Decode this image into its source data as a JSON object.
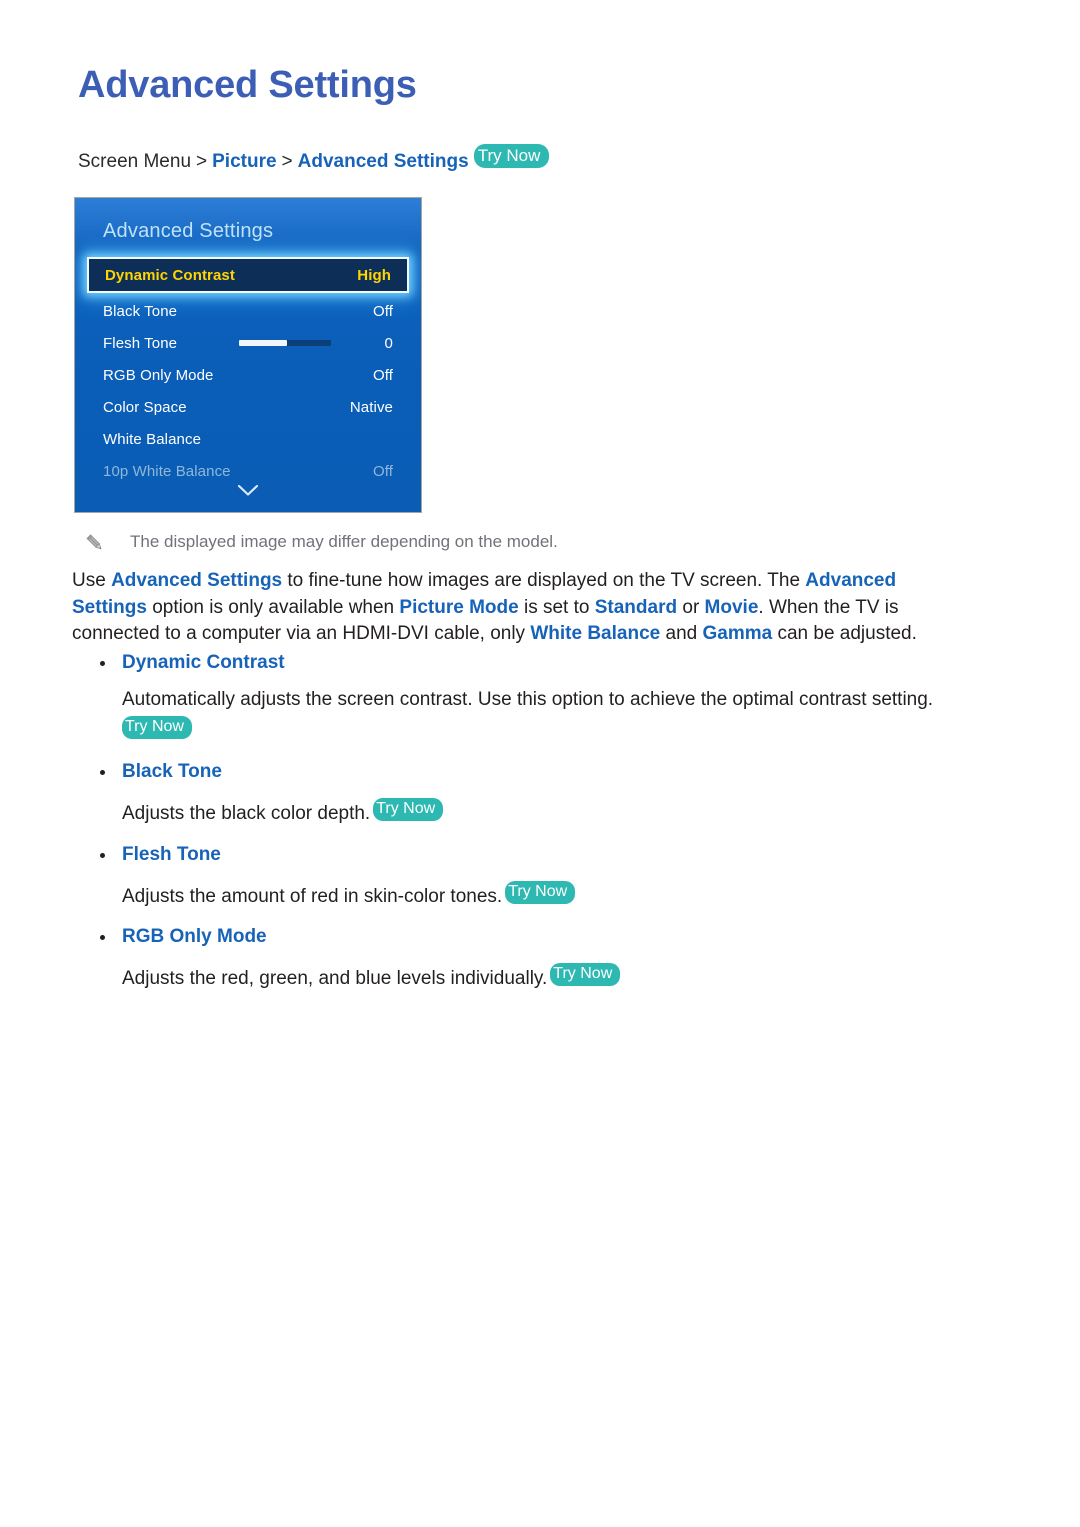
{
  "page": {
    "title": "Advanced Settings"
  },
  "breadcrumb": {
    "root": "Screen Menu",
    "sep1": ">",
    "level2": "Picture",
    "sep2": ">",
    "level3": "Advanced Settings",
    "try_now": "Try Now"
  },
  "tv_menu": {
    "header_title": "Advanced Settings",
    "selected_row": {
      "label": "Dynamic Contrast",
      "value": "High"
    },
    "rows": [
      {
        "label": "Black Tone",
        "value": "Off",
        "dimmed": false,
        "slider": null
      },
      {
        "label": "Flesh Tone",
        "value": "0",
        "dimmed": false,
        "slider": 52
      },
      {
        "label": "RGB Only Mode",
        "value": "Off",
        "dimmed": false,
        "slider": null
      },
      {
        "label": "Color Space",
        "value": "Native",
        "dimmed": false,
        "slider": null
      },
      {
        "label": "White Balance",
        "value": "",
        "dimmed": false,
        "slider": null
      },
      {
        "label": "10p White Balance",
        "value": "Off",
        "dimmed": true,
        "slider": null
      }
    ],
    "scroll_indicator": "chevron-down-icon"
  },
  "note": {
    "icon": "pencil-icon",
    "text": "The displayed image may differ depending on the model."
  },
  "intro": {
    "t1": "Use ",
    "h1": "Advanced Settings",
    "t2": " to fine-tune how images are displayed on the TV screen. The ",
    "h2": "Advanced Settings",
    "t3": " option is only available when ",
    "h3": "Picture Mode",
    "t4": " is set to ",
    "h4": "Standard",
    "t5": " or ",
    "h5": "Movie",
    "t6": ". When the TV is connected to a computer via an HDMI-DVI cable, only ",
    "h6": "White Balance",
    "t7": " and ",
    "h7": "Gamma",
    "t8": " can be adjusted."
  },
  "sections": [
    {
      "heading": "Dynamic Contrast",
      "description": "Automatically adjusts the screen contrast. Use this option to achieve the optimal contrast setting.",
      "try_now": "Try Now",
      "break_before_badge": true
    },
    {
      "heading": "Black Tone",
      "description": "Adjusts the black color depth.",
      "try_now": "Try Now",
      "break_before_badge": false
    },
    {
      "heading": "Flesh Tone",
      "description": "Adjusts the amount of red in skin-color tones.",
      "try_now": "Try Now",
      "break_before_badge": false
    },
    {
      "heading": "RGB Only Mode",
      "description": "Adjusts the red, green, and blue levels individually.",
      "try_now": "Try Now",
      "break_before_badge": false
    }
  ],
  "colors": {
    "title_blue": "#3c5eb5",
    "link_blue": "#1763b8",
    "try_now_teal": "#2eb8b2",
    "panel_blue": "#0b5fb9",
    "selected_row_bg": "#0d2f57",
    "selected_row_text": "#ffd400",
    "note_gray": "#73717a"
  }
}
